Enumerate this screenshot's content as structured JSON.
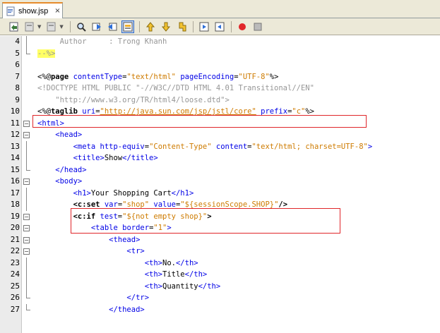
{
  "tab": {
    "label": "show.jsp",
    "close": "×"
  },
  "toolbar": {
    "buttons": [
      "back-history-icon",
      "forward-icon",
      "last-edit-icon",
      "find-icon",
      "find-previous-icon",
      "find-next-icon",
      "toggle-highlight-icon",
      "shift-left-icon",
      "shift-right-icon",
      "bookmark-icon",
      "comment-icon",
      "uncomment-icon",
      "record-macro-icon",
      "stop-macro-icon"
    ]
  },
  "editor": {
    "lines": [
      {
        "num": "4",
        "tokens": [
          {
            "t": "     Author     : Trong Khanh",
            "c": "c-comment"
          }
        ]
      },
      {
        "num": "5",
        "tokens": [
          {
            "t": "--%>",
            "c": "c-comment c-hl"
          }
        ]
      },
      {
        "num": "6",
        "tokens": []
      },
      {
        "num": "7",
        "tokens": [
          {
            "t": "<%@",
            "c": "c-jsp"
          },
          {
            "t": "page",
            "c": "c-dir"
          },
          {
            "t": " contentType",
            "c": "c-attr"
          },
          {
            "t": "=",
            "c": "c-text"
          },
          {
            "t": "\"text/html\"",
            "c": "c-val"
          },
          {
            "t": " pageEncoding",
            "c": "c-attr"
          },
          {
            "t": "=",
            "c": "c-text"
          },
          {
            "t": "\"UTF-8\"",
            "c": "c-val"
          },
          {
            "t": "%>",
            "c": "c-jsp"
          }
        ]
      },
      {
        "num": "8",
        "tokens": [
          {
            "t": "<!DOCTYPE HTML PUBLIC \"-//W3C//DTD HTML 4.01 Transitional//EN\"",
            "c": "c-doctype"
          }
        ]
      },
      {
        "num": "9",
        "tokens": [
          {
            "t": "    \"http://www.w3.org/TR/html4/loose.dtd\">",
            "c": "c-doctype"
          }
        ]
      },
      {
        "num": "10",
        "tokens": [
          {
            "t": "<%@",
            "c": "c-jsp"
          },
          {
            "t": "taglib",
            "c": "c-dir"
          },
          {
            "t": " uri",
            "c": "c-attr"
          },
          {
            "t": "=",
            "c": "c-text"
          },
          {
            "t": "\"http://java.sun.com/jsp/jstl/core\"",
            "c": "c-val c-url"
          },
          {
            "t": " prefix",
            "c": "c-attr"
          },
          {
            "t": "=",
            "c": "c-text"
          },
          {
            "t": "\"c\"",
            "c": "c-val"
          },
          {
            "t": "%>",
            "c": "c-jsp"
          }
        ]
      },
      {
        "num": "11",
        "tokens": [
          {
            "t": "<html>",
            "c": "c-tag"
          }
        ]
      },
      {
        "num": "12",
        "tokens": [
          {
            "t": "    <head>",
            "c": "c-tag"
          }
        ]
      },
      {
        "num": "13",
        "tokens": [
          {
            "t": "        <meta",
            "c": "c-tag"
          },
          {
            "t": " http-equiv",
            "c": "c-attr"
          },
          {
            "t": "=",
            "c": "c-text"
          },
          {
            "t": "\"Content-Type\"",
            "c": "c-val"
          },
          {
            "t": " content",
            "c": "c-attr"
          },
          {
            "t": "=",
            "c": "c-text"
          },
          {
            "t": "\"text/html; charset=UTF-8\"",
            "c": "c-val"
          },
          {
            "t": ">",
            "c": "c-tag"
          }
        ]
      },
      {
        "num": "14",
        "tokens": [
          {
            "t": "        <title>",
            "c": "c-tag"
          },
          {
            "t": "Show",
            "c": "c-text"
          },
          {
            "t": "</title>",
            "c": "c-tag"
          }
        ]
      },
      {
        "num": "15",
        "tokens": [
          {
            "t": "    </head>",
            "c": "c-tag"
          }
        ]
      },
      {
        "num": "16",
        "tokens": [
          {
            "t": "    <body>",
            "c": "c-tag"
          }
        ]
      },
      {
        "num": "17",
        "tokens": [
          {
            "t": "        <h1>",
            "c": "c-tag"
          },
          {
            "t": "Your Shopping Cart",
            "c": "c-text"
          },
          {
            "t": "</h1>",
            "c": "c-tag"
          }
        ]
      },
      {
        "num": "18",
        "tokens": [
          {
            "t": "        ",
            "c": "c-text"
          },
          {
            "t": "<c:set",
            "c": "c-dir"
          },
          {
            "t": " var",
            "c": "c-attr"
          },
          {
            "t": "=",
            "c": "c-text"
          },
          {
            "t": "\"shop\"",
            "c": "c-val"
          },
          {
            "t": " value",
            "c": "c-attr"
          },
          {
            "t": "=",
            "c": "c-text"
          },
          {
            "t": "\"${sessionScope.SHOP}\"",
            "c": "c-val"
          },
          {
            "t": "/>",
            "c": "c-dir"
          }
        ]
      },
      {
        "num": "19",
        "tokens": [
          {
            "t": "        ",
            "c": "c-text"
          },
          {
            "t": "<c:if",
            "c": "c-dir"
          },
          {
            "t": " test",
            "c": "c-attr"
          },
          {
            "t": "=",
            "c": "c-text"
          },
          {
            "t": "\"${not empty shop}\"",
            "c": "c-val"
          },
          {
            "t": ">",
            "c": "c-dir"
          }
        ]
      },
      {
        "num": "20",
        "tokens": [
          {
            "t": "            <table",
            "c": "c-tag"
          },
          {
            "t": " border",
            "c": "c-attr"
          },
          {
            "t": "=",
            "c": "c-text"
          },
          {
            "t": "\"1\"",
            "c": "c-val"
          },
          {
            "t": ">",
            "c": "c-tag"
          }
        ]
      },
      {
        "num": "21",
        "tokens": [
          {
            "t": "                <thead>",
            "c": "c-tag"
          }
        ]
      },
      {
        "num": "22",
        "tokens": [
          {
            "t": "                    <tr>",
            "c": "c-tag"
          }
        ]
      },
      {
        "num": "23",
        "tokens": [
          {
            "t": "                        <th>",
            "c": "c-tag"
          },
          {
            "t": "No.",
            "c": "c-text"
          },
          {
            "t": "</th>",
            "c": "c-tag"
          }
        ]
      },
      {
        "num": "24",
        "tokens": [
          {
            "t": "                        <th>",
            "c": "c-tag"
          },
          {
            "t": "Title",
            "c": "c-text"
          },
          {
            "t": "</th>",
            "c": "c-tag"
          }
        ]
      },
      {
        "num": "25",
        "tokens": [
          {
            "t": "                        <th>",
            "c": "c-tag"
          },
          {
            "t": "Quantity",
            "c": "c-text"
          },
          {
            "t": "</th>",
            "c": "c-tag"
          }
        ]
      },
      {
        "num": "26",
        "tokens": [
          {
            "t": "                    </tr>",
            "c": "c-tag"
          }
        ]
      },
      {
        "num": "27",
        "tokens": [
          {
            "t": "                </thead>",
            "c": "c-tag"
          }
        ]
      }
    ]
  },
  "colors": {
    "highlight_box": "#e0262a",
    "tag": "#0000e6",
    "value": "#ce7b00",
    "comment": "#969696",
    "tab_accent": "#e68b2c"
  }
}
